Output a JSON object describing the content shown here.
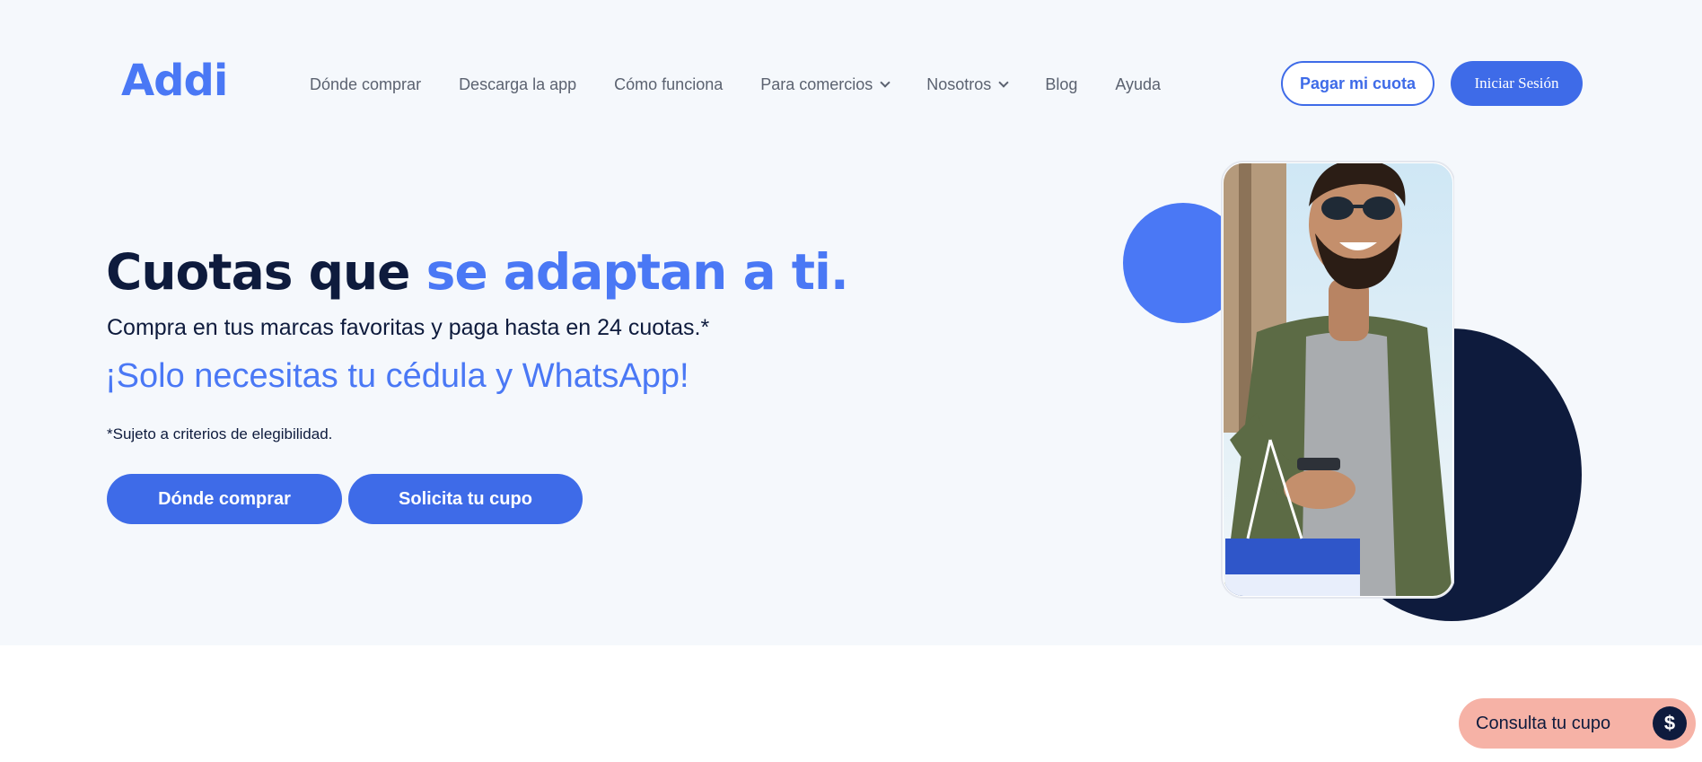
{
  "header": {
    "logo_text": "Addi",
    "nav": [
      {
        "label": "Dónde comprar",
        "dropdown": false
      },
      {
        "label": "Descarga la app",
        "dropdown": false
      },
      {
        "label": "Cómo funciona",
        "dropdown": false
      },
      {
        "label": "Para comercios",
        "dropdown": true
      },
      {
        "label": "Nosotros",
        "dropdown": true
      },
      {
        "label": "Blog",
        "dropdown": false
      },
      {
        "label": "Ayuda",
        "dropdown": false
      }
    ],
    "pay_button": "Pagar mi cuota",
    "login_button": "Iniciar Sesión"
  },
  "hero": {
    "title_main": "Cuotas que ",
    "title_accent": "se adaptan a ti.",
    "subtitle": "Compra en tus marcas favoritas y paga hasta en 24 cuotas.*",
    "highlight": "¡Solo necesitas tu cédula y WhatsApp!",
    "note": "*Sujeto a criterios de elegibilidad.",
    "cta_primary": "Dónde comprar",
    "cta_secondary": "Solicita tu cupo"
  },
  "floating": {
    "label": "Consulta tu cupo",
    "icon": "dollar-coin-icon",
    "icon_glyph": "$"
  },
  "colors": {
    "brand_blue": "#3e6be8",
    "accent_blue": "#4a78f5",
    "navy": "#0e1b3d",
    "hero_bg": "#f5f8fc",
    "float_bg": "#f6b2a6"
  }
}
